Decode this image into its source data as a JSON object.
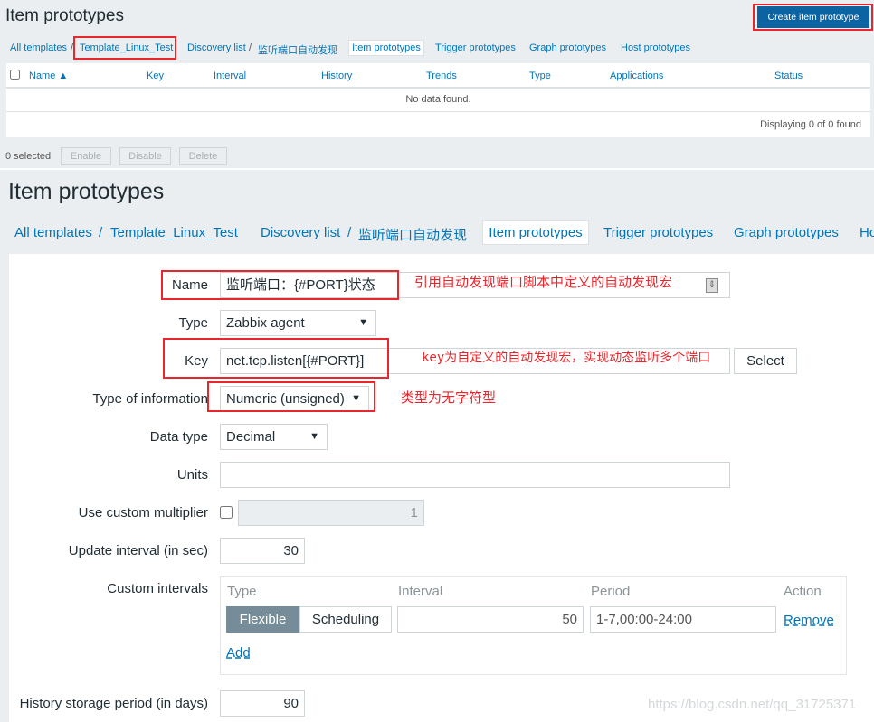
{
  "top": {
    "title": "Item prototypes",
    "create_button": "Create item prototype",
    "breadcrumb": [
      "All templates",
      "Template_Linux_Test",
      "Discovery list",
      "监听端口自动发现"
    ],
    "tabs": [
      "Item prototypes",
      "Trigger prototypes",
      "Graph prototypes",
      "Host prototypes"
    ],
    "columns": [
      "Name ▲",
      "Key",
      "Interval",
      "History",
      "Trends",
      "Type",
      "Applications",
      "Status"
    ],
    "no_data": "No data found.",
    "displaying": "Displaying 0 of 0 found",
    "selected": "0 selected",
    "actions": [
      "Enable",
      "Disable",
      "Delete"
    ]
  },
  "bottom": {
    "title": "Item prototypes",
    "breadcrumb": [
      "All templates",
      "Template_Linux_Test",
      "Discovery list",
      "监听端口自动发现"
    ],
    "tabs": [
      "Item prototypes",
      "Trigger prototypes",
      "Graph prototypes",
      "Ho"
    ],
    "form": {
      "name_label": "Name",
      "name_value": "监听端口：{#PORT}状态",
      "type_label": "Type",
      "type_value": "Zabbix agent",
      "key_label": "Key",
      "key_value": "net.tcp.listen[{#PORT}]",
      "select_button": "Select",
      "info_label": "Type of information",
      "info_value": "Numeric (unsigned)",
      "datatype_label": "Data type",
      "datatype_value": "Decimal",
      "units_label": "Units",
      "units_value": "",
      "multiplier_label": "Use custom multiplier",
      "multiplier_value": "1",
      "multiplier_checked": false,
      "update_label": "Update interval (in sec)",
      "update_value": "30",
      "custom_label": "Custom intervals",
      "ci_headers": [
        "Type",
        "Interval",
        "Period",
        "Action"
      ],
      "ci_row": {
        "type_options": [
          "Flexible",
          "Scheduling"
        ],
        "selected": "Flexible",
        "interval": "50",
        "period": "1-7,00:00-24:00",
        "remove": "Remove"
      },
      "add_link": "Add",
      "history_label": "History storage period (in days)",
      "history_value": "90"
    },
    "annotations": {
      "name": "引用自动发现端口脚本中定义的自动发现宏",
      "key": "key为自定义的自动发现宏，实现动态监听多个端口",
      "info": "类型为无字符型"
    },
    "watermark": "https://blog.csdn.net/qq_31725371"
  },
  "colors": {
    "link": "#0275b8",
    "primary": "#0b63a1",
    "highlight": "#e8262b"
  }
}
